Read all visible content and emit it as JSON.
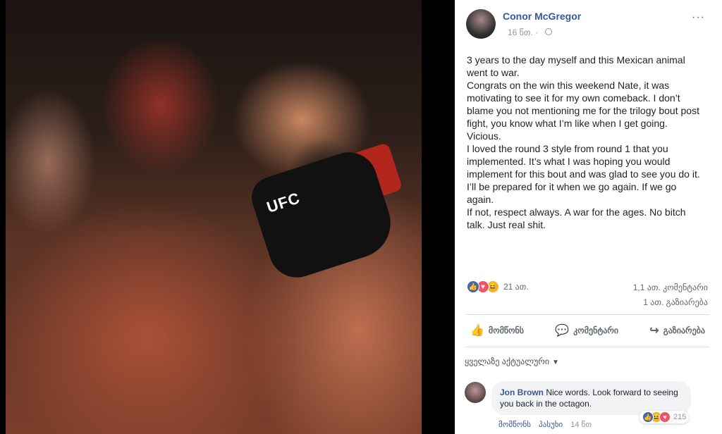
{
  "photo": {
    "glove_text": "UFC"
  },
  "post": {
    "author": "Conor McGregor",
    "time": "16 წთ. · ",
    "paragraphs": [
      "3 years to the day myself and this Mexican animal went to war.",
      "Congrats on the win this weekend Nate, it was motivating to see it for my own comeback. I don’t blame you not mentioning me for the trilogy bout post fight, you know what I’m like when I get going. Vicious.",
      "I loved the round 3 style from round 1 that you implemented. It’s what I was hoping you would implement for this bout and was glad to see you do it.",
      "I’ll be prepared for it when we go again. If we go again.",
      "If not, respect always. A war for the ages. No bitch talk. Just real shit."
    ],
    "more_icon": "···",
    "reactions_count": "21 ათ.",
    "comments_count": "1,1 ათ. კომენტარი",
    "shares_count": "1 ათ. გაზიარება"
  },
  "actions": {
    "like": "მომწონს",
    "comment": "კომენტარი",
    "share": "გაზიარება"
  },
  "icons": {
    "like": "👍",
    "comment": "💬",
    "share": "↪",
    "love": "♥",
    "haha": "😆"
  },
  "comments": {
    "sort_label": "ყველაზე აქტუალური",
    "sort_caret": "▼",
    "items": [
      {
        "name": "Jon Brown",
        "text": " Nice words. Look forward to seeing you back in the octagon.",
        "reactions_count": "215",
        "like_label": "მომწონს",
        "reply_label": "პასუხი",
        "time": "14 წთ"
      }
    ]
  },
  "colors": {
    "link": "#385898",
    "like": "#4267b2",
    "love": "#f25268",
    "haha": "#f7b125"
  }
}
